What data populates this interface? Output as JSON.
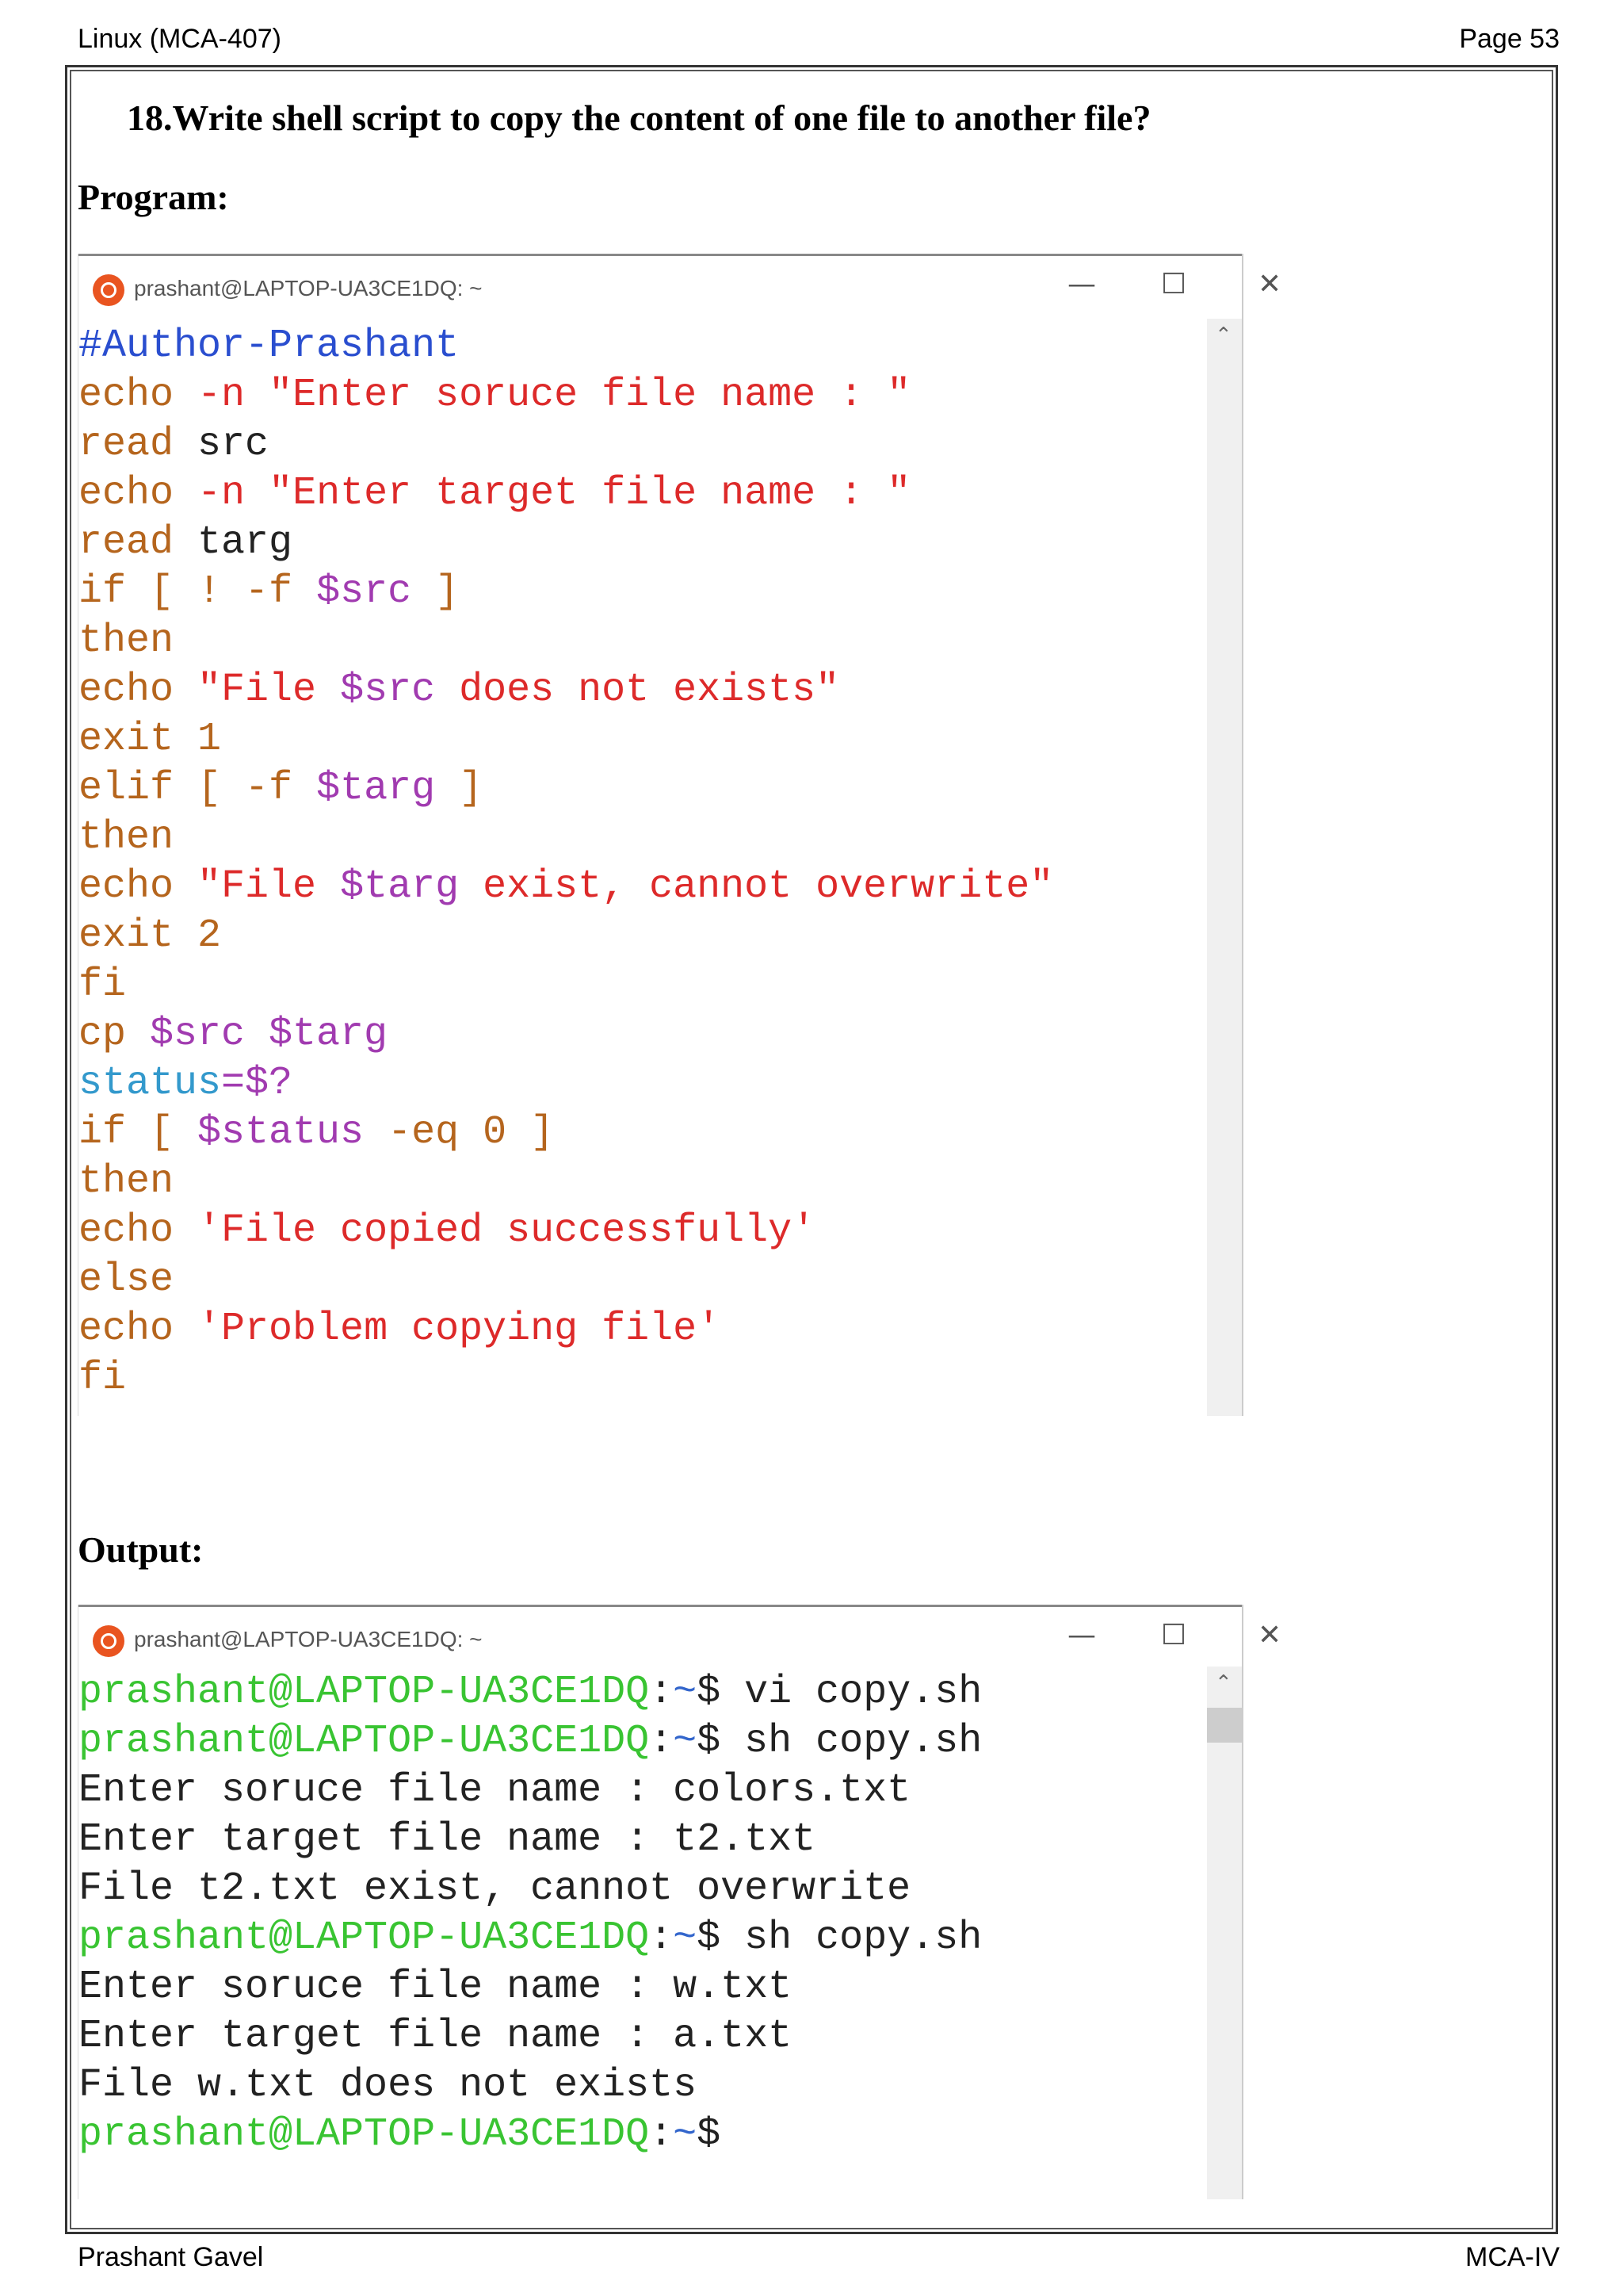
{
  "header": {
    "left": "Linux (MCA-407)",
    "right": "Page 53"
  },
  "question": "18.Write shell script to copy the content of one file to another file?",
  "program_label": "Program:",
  "output_label": "Output:",
  "window": {
    "title": "prashant@LAPTOP-UA3CE1DQ: ~",
    "min": "—",
    "max": "☐",
    "close": "✕"
  },
  "program_lines": [
    [
      {
        "t": "#Author-Prashant",
        "c": "cmt"
      }
    ],
    [
      {
        "t": "echo",
        "c": "kw"
      },
      {
        "t": " -n ",
        "c": "str"
      },
      {
        "t": "\"Enter soruce file name : \"",
        "c": "str"
      }
    ],
    [
      {
        "t": "read",
        "c": "kw"
      },
      {
        "t": " src",
        "c": "plain"
      }
    ],
    [
      {
        "t": "echo",
        "c": "kw"
      },
      {
        "t": " -n ",
        "c": "str"
      },
      {
        "t": "\"Enter target file name : \"",
        "c": "str"
      }
    ],
    [
      {
        "t": "read",
        "c": "kw"
      },
      {
        "t": " targ",
        "c": "plain"
      }
    ],
    [
      {
        "t": "if [ ! -f ",
        "c": "kw"
      },
      {
        "t": "$src",
        "c": "var"
      },
      {
        "t": " ]",
        "c": "kw"
      }
    ],
    [
      {
        "t": "then",
        "c": "kw"
      }
    ],
    [
      {
        "t": "echo ",
        "c": "kw"
      },
      {
        "t": "\"File ",
        "c": "str"
      },
      {
        "t": "$src",
        "c": "var"
      },
      {
        "t": " does not exists\"",
        "c": "str"
      }
    ],
    [
      {
        "t": "exit 1",
        "c": "kw"
      }
    ],
    [
      {
        "t": "elif [ -f ",
        "c": "kw"
      },
      {
        "t": "$targ",
        "c": "var"
      },
      {
        "t": " ]",
        "c": "kw"
      }
    ],
    [
      {
        "t": "then",
        "c": "kw"
      }
    ],
    [
      {
        "t": "echo ",
        "c": "kw"
      },
      {
        "t": "\"File ",
        "c": "str"
      },
      {
        "t": "$targ",
        "c": "var"
      },
      {
        "t": " exist, cannot overwrite\"",
        "c": "str"
      }
    ],
    [
      {
        "t": "exit 2",
        "c": "kw"
      }
    ],
    [
      {
        "t": "fi",
        "c": "kw"
      }
    ],
    [
      {
        "t": "cp ",
        "c": "kw"
      },
      {
        "t": "$src $targ",
        "c": "var"
      }
    ],
    [
      {
        "t": "status",
        "c": "cy"
      },
      {
        "t": "=$?",
        "c": "var"
      }
    ],
    [
      {
        "t": "if [ ",
        "c": "kw"
      },
      {
        "t": "$status",
        "c": "var"
      },
      {
        "t": " -eq 0 ]",
        "c": "kw"
      }
    ],
    [
      {
        "t": "then",
        "c": "kw"
      }
    ],
    [
      {
        "t": "echo ",
        "c": "kw"
      },
      {
        "t": "'File copied successfully'",
        "c": "str"
      }
    ],
    [
      {
        "t": "else",
        "c": "kw"
      }
    ],
    [
      {
        "t": "echo ",
        "c": "kw"
      },
      {
        "t": "'Problem copying file'",
        "c": "str"
      }
    ],
    [
      {
        "t": "fi",
        "c": "kw"
      }
    ]
  ],
  "output_lines": [
    [
      {
        "t": "prashant@LAPTOP-UA3CE1DQ",
        "c": "prompt"
      },
      {
        "t": ":",
        "c": "plain"
      },
      {
        "t": "~",
        "c": "pdollar"
      },
      {
        "t": "$ vi copy.sh",
        "c": "plain"
      }
    ],
    [
      {
        "t": "prashant@LAPTOP-UA3CE1DQ",
        "c": "prompt"
      },
      {
        "t": ":",
        "c": "plain"
      },
      {
        "t": "~",
        "c": "pdollar"
      },
      {
        "t": "$ sh copy.sh",
        "c": "plain"
      }
    ],
    [
      {
        "t": "Enter soruce file name : colors.txt",
        "c": "plain"
      }
    ],
    [
      {
        "t": "Enter target file name : t2.txt",
        "c": "plain"
      }
    ],
    [
      {
        "t": "File t2.txt exist, cannot overwrite",
        "c": "plain"
      }
    ],
    [
      {
        "t": "prashant@LAPTOP-UA3CE1DQ",
        "c": "prompt"
      },
      {
        "t": ":",
        "c": "plain"
      },
      {
        "t": "~",
        "c": "pdollar"
      },
      {
        "t": "$ sh copy.sh",
        "c": "plain"
      }
    ],
    [
      {
        "t": "Enter soruce file name : w.txt",
        "c": "plain"
      }
    ],
    [
      {
        "t": "Enter target file name : a.txt",
        "c": "plain"
      }
    ],
    [
      {
        "t": "File w.txt does not exists",
        "c": "plain"
      }
    ],
    [
      {
        "t": "prashant@LAPTOP-UA3CE1DQ",
        "c": "prompt"
      },
      {
        "t": ":",
        "c": "plain"
      },
      {
        "t": "~",
        "c": "pdollar"
      },
      {
        "t": "$",
        "c": "plain"
      }
    ]
  ],
  "footer": {
    "left": "Prashant Gavel",
    "right": "MCA-IV"
  },
  "colors": {
    "keyword": "#b5651d",
    "string": "#dd2a2a",
    "variable": "#a13bb0",
    "comment": "#2a4ecf",
    "prompt": "#39c432"
  }
}
